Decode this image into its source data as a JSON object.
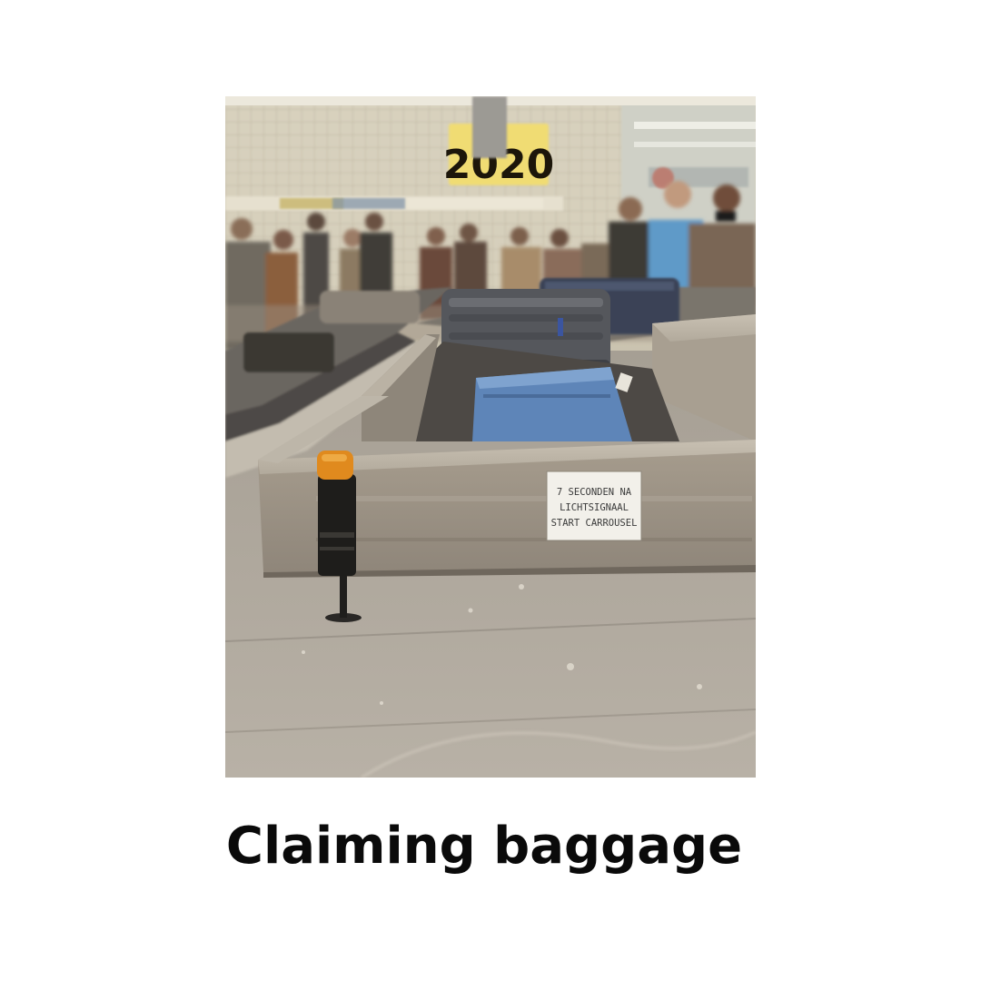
{
  "photo": {
    "board_number": "2020",
    "sign_lines": [
      "7 SECONDEN NA",
      "LICHTSIGNAAL",
      "START CARROUSEL"
    ]
  },
  "caption": "Claiming baggage",
  "colors": {
    "background": "#ffffff",
    "caption_text": "#0a0a0a",
    "signal_light": "#e08a1e",
    "steel": "#9c9284"
  }
}
